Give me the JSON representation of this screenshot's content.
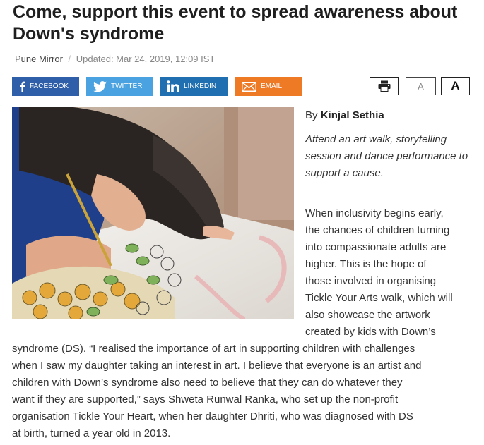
{
  "article": {
    "title": "Come, support this event to spread awareness about Down's syndrome",
    "source": "Pune Mirror",
    "separator": "/",
    "updated": "Updated: Mar 24, 2019, 12:09 IST",
    "byline_prefix": "By",
    "author": "Kinjal Sethia",
    "summary": "Attend an art walk, storytelling session and dance performance to support a cause.",
    "body_wrap_lines": [
      "When inclusivity begins early,",
      "the chances of children turning",
      "into compassionate adults are",
      "higher. This is the hope of",
      "those involved in organising",
      "Tickle Your Arts walk, which will",
      "also showcase the artwork",
      "created by kids with Down’s"
    ],
    "body_full_lines": [
      "syndrome (DS). “I realised the importance of art in supporting children with challenges",
      "when I saw my daughter taking an interest in art. I believe that everyone is an artist and",
      "children with Down’s syndrome also need to believe that they can do whatever they",
      "want if they are supported,” says Shweta Runwal Ranka, who set up the non-profit",
      "organisation Tickle Your Heart, when her daughter Dhriti, who was diagnosed with DS",
      "at birth, turned a year old in 2013."
    ]
  },
  "share": {
    "facebook": "FACEBOOK",
    "twitter": "TWITTER",
    "linkedin": "LINKEDIN",
    "email": "EMAIL",
    "colors": {
      "facebook": "#2f5fa8",
      "twitter": "#4aa3e0",
      "linkedin": "#1f6fb1",
      "email": "#ef7a26"
    }
  },
  "tools": {
    "font_small": "A",
    "font_large": "A",
    "print_icon": "printer-icon"
  }
}
